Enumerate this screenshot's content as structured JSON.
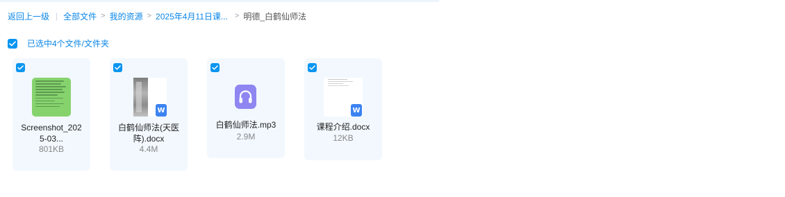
{
  "breadcrumb": {
    "back": "返回上一级",
    "items": [
      "全部文件",
      "我的资源",
      "2025年4月11日课...",
      "明德_白鹤仙师法"
    ]
  },
  "selection": {
    "label": "已选中4个文件/文件夹",
    "checked": true
  },
  "files": [
    {
      "name": "Screenshot_2025-03...",
      "size": "801KB",
      "icon": "image-thumbnail",
      "checked": true
    },
    {
      "name": "白鹤仙师法(天医阵).docx",
      "size": "4.4M",
      "icon": "word-doc-icon",
      "checked": true
    },
    {
      "name": "白鹤仙师法.mp3",
      "size": "2.9M",
      "icon": "audio-file-icon",
      "checked": true
    },
    {
      "name": "课程介绍.docx",
      "size": "12KB",
      "icon": "word-doc-icon",
      "checked": true
    }
  ],
  "colors": {
    "accent": "#0a86e8",
    "card_bg": "#f2f8fe",
    "audio_icon": "#8f86f2",
    "word_badge": "#3b83f0"
  }
}
